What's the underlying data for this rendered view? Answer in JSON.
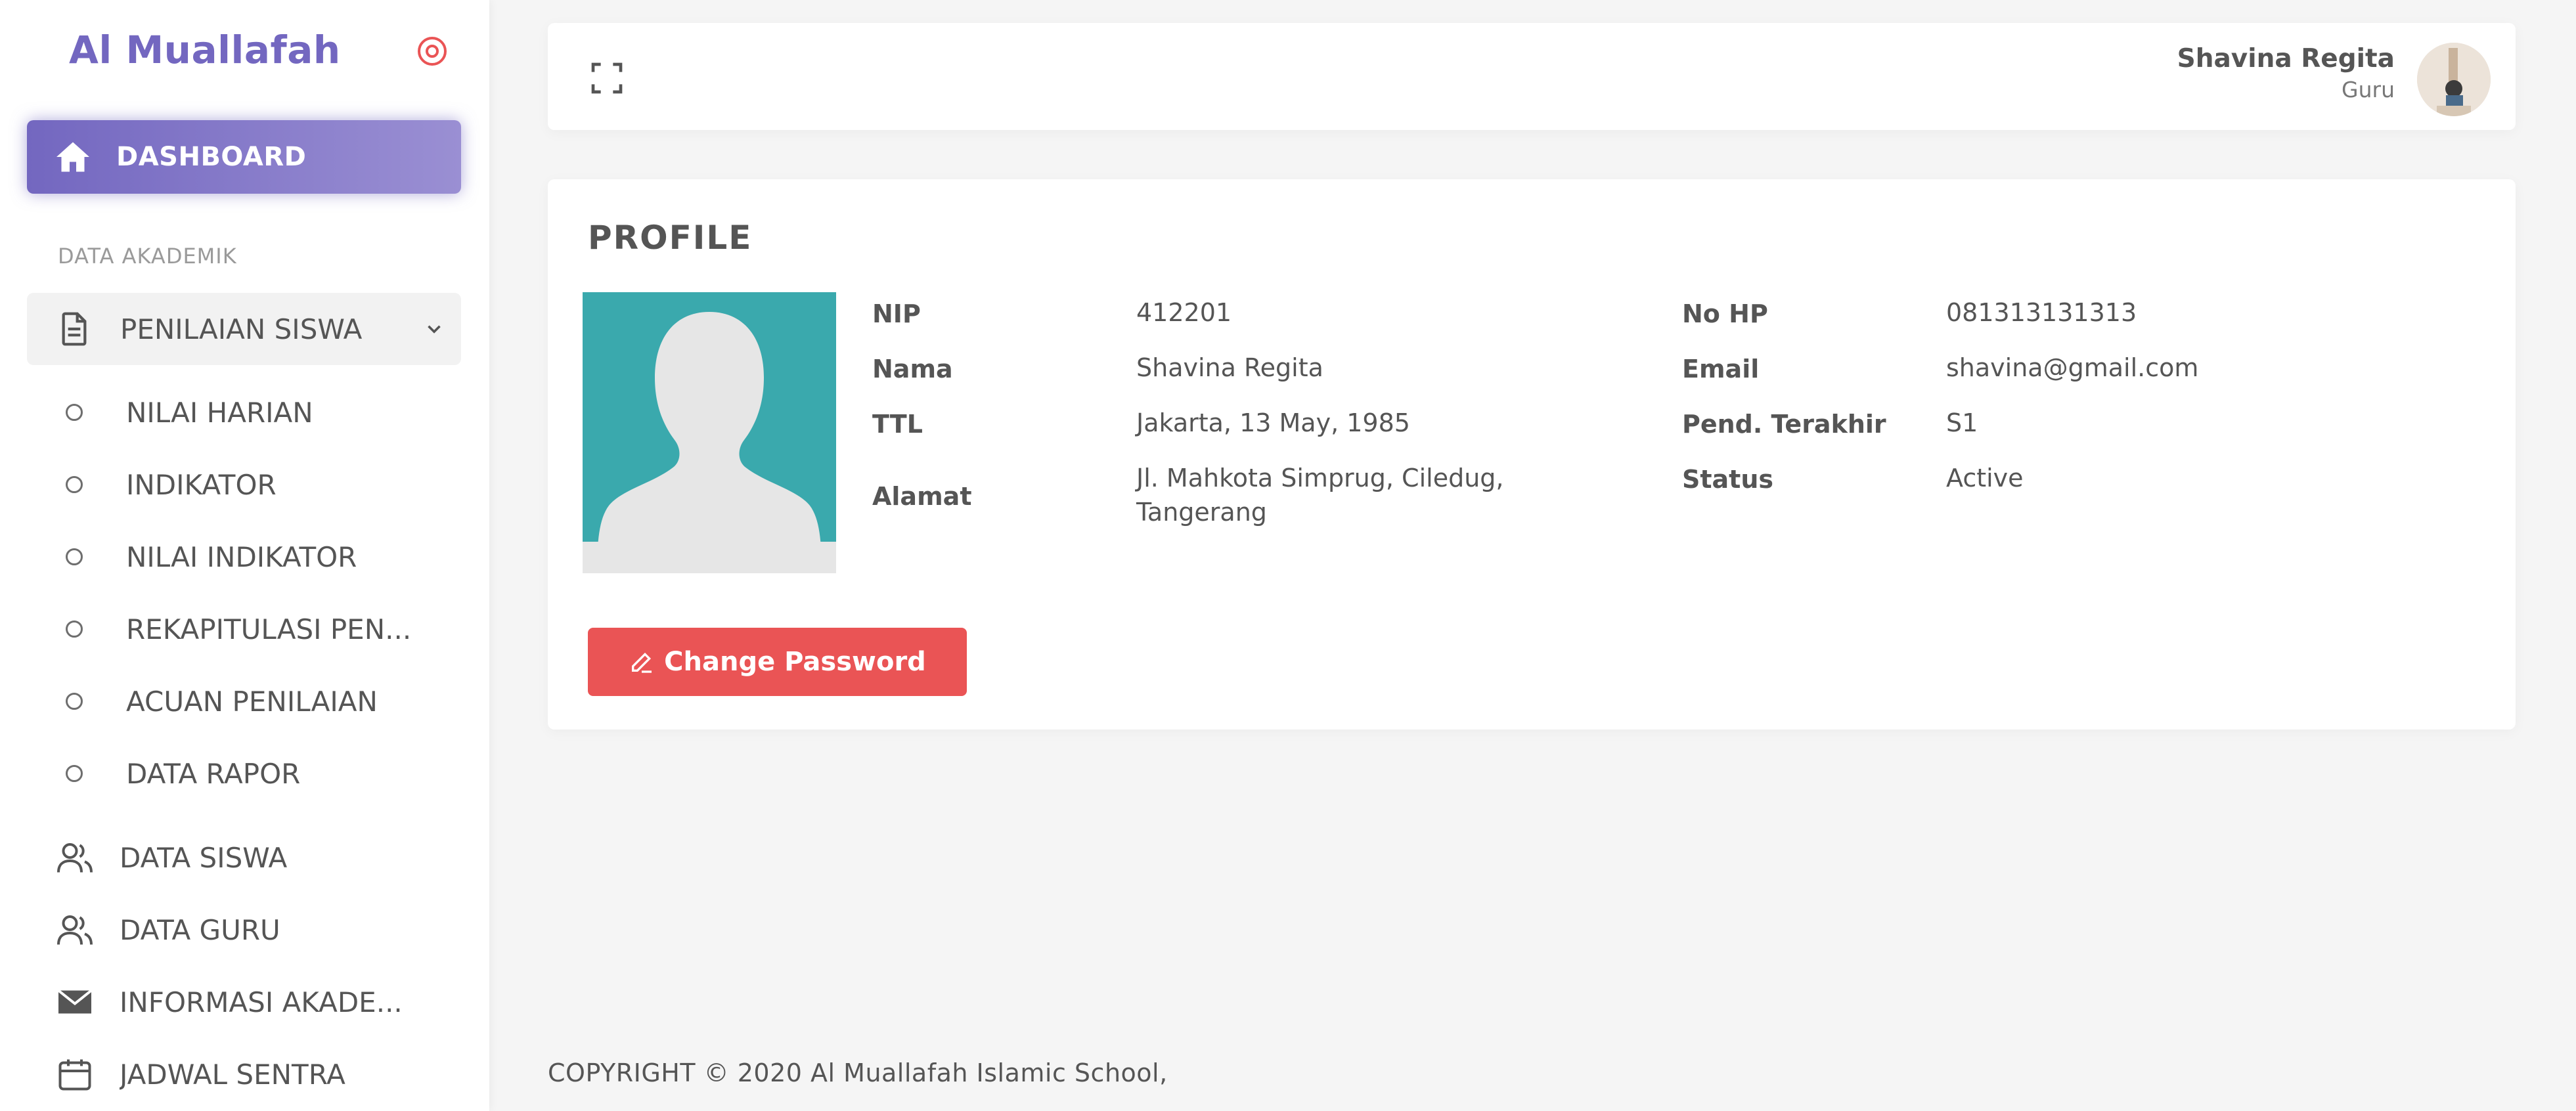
{
  "app": {
    "brand": "Al Muallafah"
  },
  "sidebar": {
    "dashboard_label": "DASHBOARD",
    "section_title": "DATA AKADEMIK",
    "group_label": "PENILAIAN SISWA",
    "sub_items": [
      {
        "label": "NILAI HARIAN"
      },
      {
        "label": "INDIKATOR"
      },
      {
        "label": "NILAI INDIKATOR"
      },
      {
        "label": "REKAPITULASI PEN..."
      },
      {
        "label": "ACUAN PENILAIAN"
      },
      {
        "label": "DATA RAPOR"
      }
    ],
    "items": [
      {
        "label": "DATA SISWA",
        "icon": "users-icon"
      },
      {
        "label": "DATA GURU",
        "icon": "users-icon"
      },
      {
        "label": "INFORMASI AKADE...",
        "icon": "envelope-icon"
      },
      {
        "label": "JADWAL SENTRA",
        "icon": "calendar-icon"
      }
    ]
  },
  "header": {
    "user_name": "Shavina Regita",
    "user_role": "Guru"
  },
  "profile": {
    "title": "PROFILE",
    "left": [
      {
        "label": "NIP",
        "value": "412201"
      },
      {
        "label": "Nama",
        "value": "Shavina Regita"
      },
      {
        "label": "TTL",
        "value": "Jakarta, 13 May, 1985"
      },
      {
        "label": "Alamat",
        "value": "Jl. Mahkota Simprug, Ciledug, Tangerang"
      }
    ],
    "right": [
      {
        "label": "No HP",
        "value": "081313131313"
      },
      {
        "label": "Email",
        "value": "shavina@gmail.com"
      },
      {
        "label": "Pend. Terakhir",
        "value": "S1"
      },
      {
        "label": "Status",
        "value": "Active"
      }
    ],
    "change_password_label": "Change Password"
  },
  "footer": {
    "text": "COPYRIGHT © 2020 Al Muallafah Islamic School,"
  },
  "colors": {
    "accent": "#7367c0",
    "danger": "#ea5455",
    "photo_bg": "#3aa9ad"
  }
}
